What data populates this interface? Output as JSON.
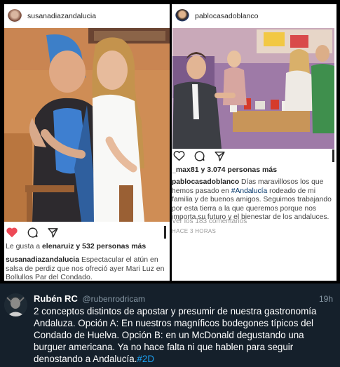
{
  "post_left": {
    "username": "susanadiazandalucia",
    "likes_prefix": "Le gusta a",
    "likes_user": "elenaruiz",
    "likes_suffix": "y 532 personas más",
    "caption_user": "susanadiazandalucia",
    "caption_text": "Espectacular el atún en salsa de perdiz que nos ofreció ayer Mari Luz en Bollullos Par del Condado."
  },
  "post_right": {
    "username": "pablocasadoblanco",
    "likes_user": "_max81",
    "likes_suffix": "y 3.074 personas más",
    "caption_user": "pablocasadoblanco",
    "caption_text_1": "Días maravillosos los que hemos pasado en",
    "caption_hashtag": "#Andalucía",
    "caption_text_2": "rodeado de mi familia y de buenos amigos. Seguimos trabajando por esta tierra a la que queremos porque nos importa su futuro y el bienestar de los andaluces.",
    "comments_link": "Ver los 183 comentarios",
    "timestamp": "HACE 3 HORAS"
  },
  "tweet": {
    "name": "Rubén RC",
    "handle": "@rubenrodricam",
    "time": "19h",
    "text": "2 conceptos distintos de apostar y presumir de nuestra gastronomía Andaluza. Opción A: En nuestros magníficos bodegones típicos del Condado de Huelva. Opción B: en un McDonald degustando una burguer americana. Ya no hace falta ni que hablen para seguir denostando a Andalucía.",
    "hashtag": "#2D"
  },
  "colors": {
    "tweet_background": "#15202b",
    "twitter_link": "#1da1f2",
    "like_heart": "#ed4956",
    "instagram_hashtag": "#003569"
  },
  "icons": [
    "heart-icon",
    "comment-icon",
    "share-icon",
    "bookmark-icon"
  ]
}
